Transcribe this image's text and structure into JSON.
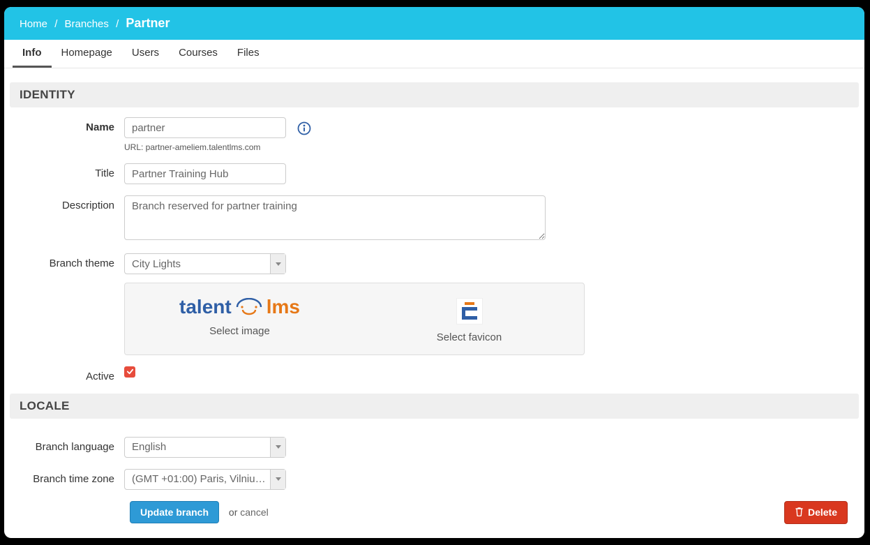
{
  "breadcrumb": {
    "home": "Home",
    "branches": "Branches",
    "current": "Partner"
  },
  "tabs": {
    "info": "Info",
    "homepage": "Homepage",
    "users": "Users",
    "courses": "Courses",
    "files": "Files"
  },
  "sections": {
    "identity": "IDENTITY",
    "locale": "LOCALE"
  },
  "labels": {
    "name": "Name",
    "title": "Title",
    "description": "Description",
    "branch_theme": "Branch theme",
    "active": "Active",
    "branch_language": "Branch language",
    "branch_time_zone": "Branch time zone"
  },
  "values": {
    "name": "partner",
    "url_line": "URL: partner-ameliem.talentlms.com",
    "title": "Partner Training Hub",
    "description": "Branch reserved for partner training",
    "branch_theme": "City Lights",
    "branch_language": "English",
    "branch_time_zone": "(GMT +01:00) Paris, Vilnius, ...",
    "active_checked": true
  },
  "image_box": {
    "select_image": "Select image",
    "select_favicon": "Select favicon",
    "logo_part1": "talent",
    "logo_part2": "lms"
  },
  "buttons": {
    "update": "Update branch",
    "or": "or ",
    "cancel": "cancel",
    "delete": "Delete"
  }
}
